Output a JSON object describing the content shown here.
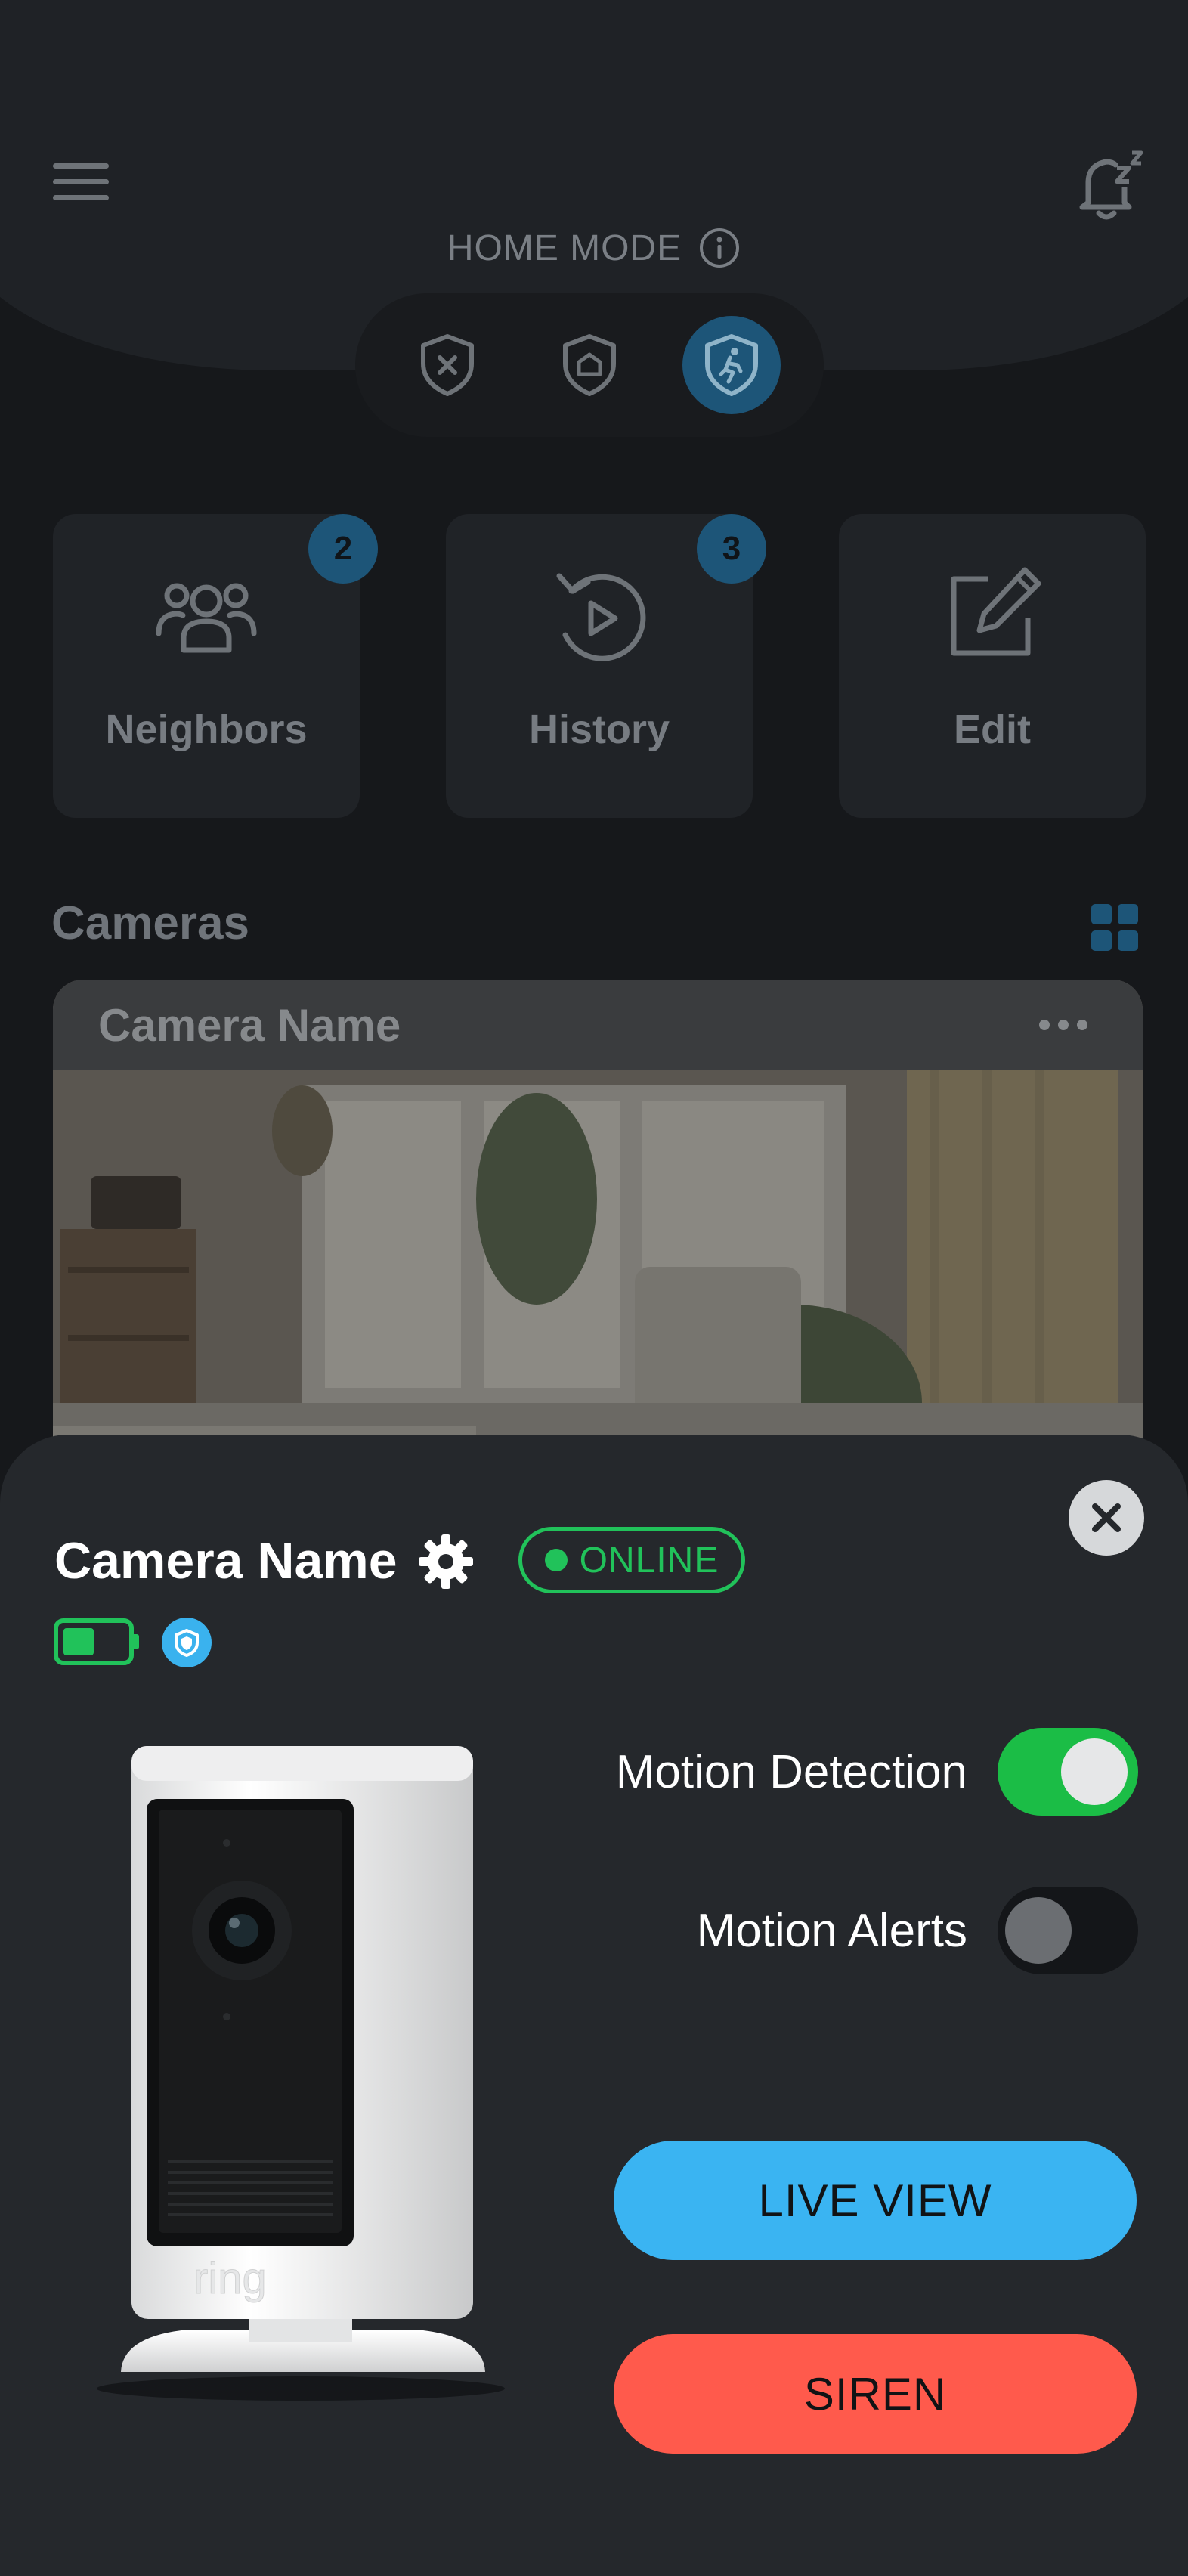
{
  "header": {
    "home_mode_label": "HOME MODE",
    "menu_icon": "hamburger-menu-icon",
    "snooze_icon": "bell-snooze-icon",
    "info_icon": "info-icon"
  },
  "modes": [
    {
      "icon": "shield-disarmed-icon",
      "active": false
    },
    {
      "icon": "shield-home-icon",
      "active": false
    },
    {
      "icon": "shield-away-icon",
      "active": true
    }
  ],
  "tiles": [
    {
      "label": "Neighbors",
      "icon": "neighbors-icon",
      "badge": "2"
    },
    {
      "label": "History",
      "icon": "history-icon",
      "badge": "3"
    },
    {
      "label": "Edit",
      "icon": "edit-icon",
      "badge": ""
    }
  ],
  "cameras_section": {
    "title": "Cameras",
    "card_title": "Camera Name"
  },
  "sheet": {
    "title": "Camera Name",
    "status": "ONLINE",
    "toggles": [
      {
        "label": "Motion Detection",
        "on": true
      },
      {
        "label": "Motion Alerts",
        "on": false
      }
    ],
    "live_view_label": "LIVE VIEW",
    "siren_label": "SIREN",
    "device_logo": "ring"
  },
  "colors": {
    "accent_blue": "#3ab4f2",
    "online_green": "#21c25a",
    "siren_red": "#ff5a4c",
    "sheet_bg": "#25282c"
  }
}
